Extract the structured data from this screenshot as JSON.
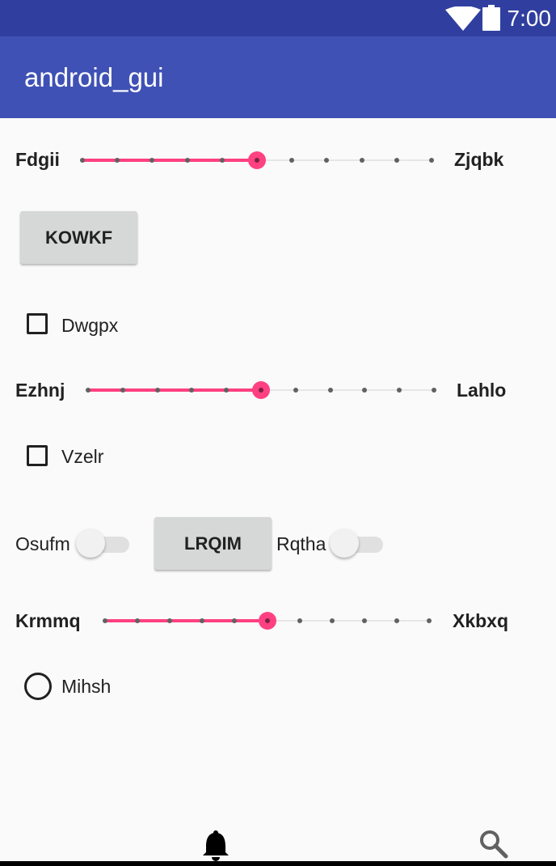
{
  "status_bar": {
    "time": "7:00",
    "icons": [
      "wifi-icon",
      "battery-icon"
    ]
  },
  "app_bar": {
    "title": "android_gui"
  },
  "seekbar_1": {
    "left_label": "Fdgii",
    "right_label": "Zjqbk",
    "steps": 10,
    "value": 5
  },
  "button_1": {
    "label": "KOWKF"
  },
  "checkbox_1": {
    "label": "Dwgpx",
    "checked": false
  },
  "seekbar_2": {
    "left_label": "Ezhnj",
    "right_label": "Lahlo",
    "steps": 10,
    "value": 5
  },
  "checkbox_2": {
    "label": "Vzelr",
    "checked": false
  },
  "switch_1": {
    "label": "Osufm",
    "on": false
  },
  "button_2": {
    "label": "LRQIM"
  },
  "switch_2": {
    "label": "Rqtha",
    "on": false
  },
  "seekbar_3": {
    "left_label": "Krmmq",
    "right_label": "Xkbxq",
    "steps": 10,
    "value": 5
  },
  "radio_1": {
    "label": "Mihsh",
    "checked": false
  },
  "bottom_nav": {
    "icons": [
      "bell-icon",
      "search-icon"
    ]
  },
  "colors": {
    "primary": "#3f51b5",
    "primary_dark": "#303f9f",
    "accent": "#ff4081",
    "background": "#fafafa"
  }
}
